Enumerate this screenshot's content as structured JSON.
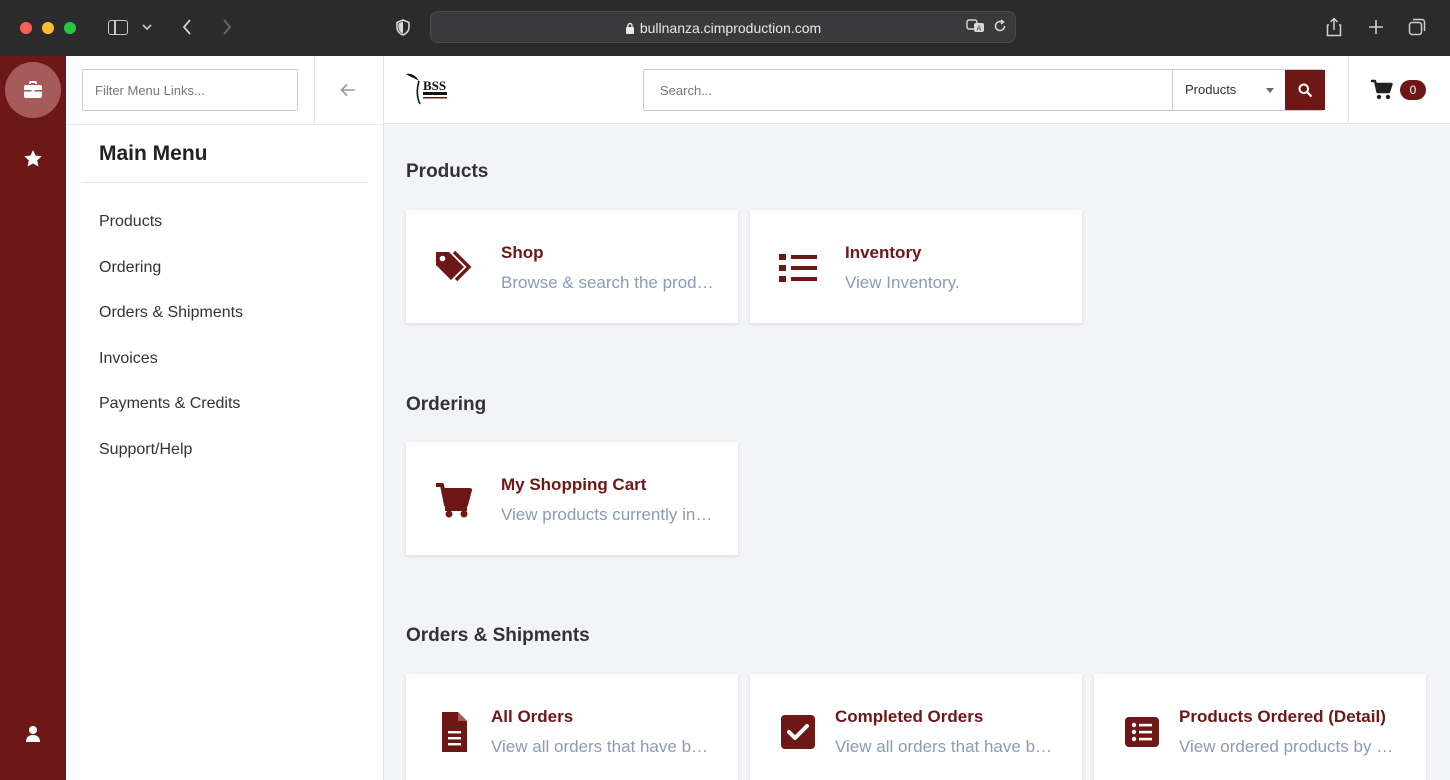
{
  "browser": {
    "url": "bullnanza.cimproduction.com"
  },
  "colors": {
    "brand": "#6e1717",
    "rail_active": "#a65a5a",
    "desc_text": "#8b9bb2"
  },
  "rail": {
    "items": [
      {
        "icon": "briefcase-icon",
        "active": true
      },
      {
        "icon": "star-icon",
        "active": false
      },
      {
        "icon": "user-icon",
        "active": false
      }
    ]
  },
  "menu_panel": {
    "filter_placeholder": "Filter Menu Links...",
    "title": "Main Menu",
    "items": [
      {
        "label": "Products"
      },
      {
        "label": "Ordering"
      },
      {
        "label": "Orders & Shipments"
      },
      {
        "label": "Invoices"
      },
      {
        "label": "Payments & Credits"
      },
      {
        "label": "Support/Help"
      }
    ]
  },
  "header": {
    "logo_text": "BSS",
    "search_placeholder": "Search...",
    "search_scope": "Products",
    "cart_count": "0"
  },
  "sections": [
    {
      "title": "Products",
      "cards": [
        {
          "icon": "tags-icon",
          "title": "Shop",
          "desc": "Browse & search the products."
        },
        {
          "icon": "list-icon",
          "title": "Inventory",
          "desc": "View Inventory."
        }
      ]
    },
    {
      "title": "Ordering",
      "cards": [
        {
          "icon": "cart-icon",
          "title": "My Shopping Cart",
          "desc": "View products currently in your cart."
        }
      ]
    },
    {
      "title": "Orders & Shipments",
      "cards": [
        {
          "icon": "document-icon",
          "title": "All Orders",
          "desc": "View all orders that have been placed."
        },
        {
          "icon": "check-square-icon",
          "title": "Completed Orders",
          "desc": "View all orders that have been completed."
        },
        {
          "icon": "list-alt-icon",
          "title": "Products Ordered (Detail)",
          "desc": "View ordered products by order."
        }
      ]
    }
  ]
}
